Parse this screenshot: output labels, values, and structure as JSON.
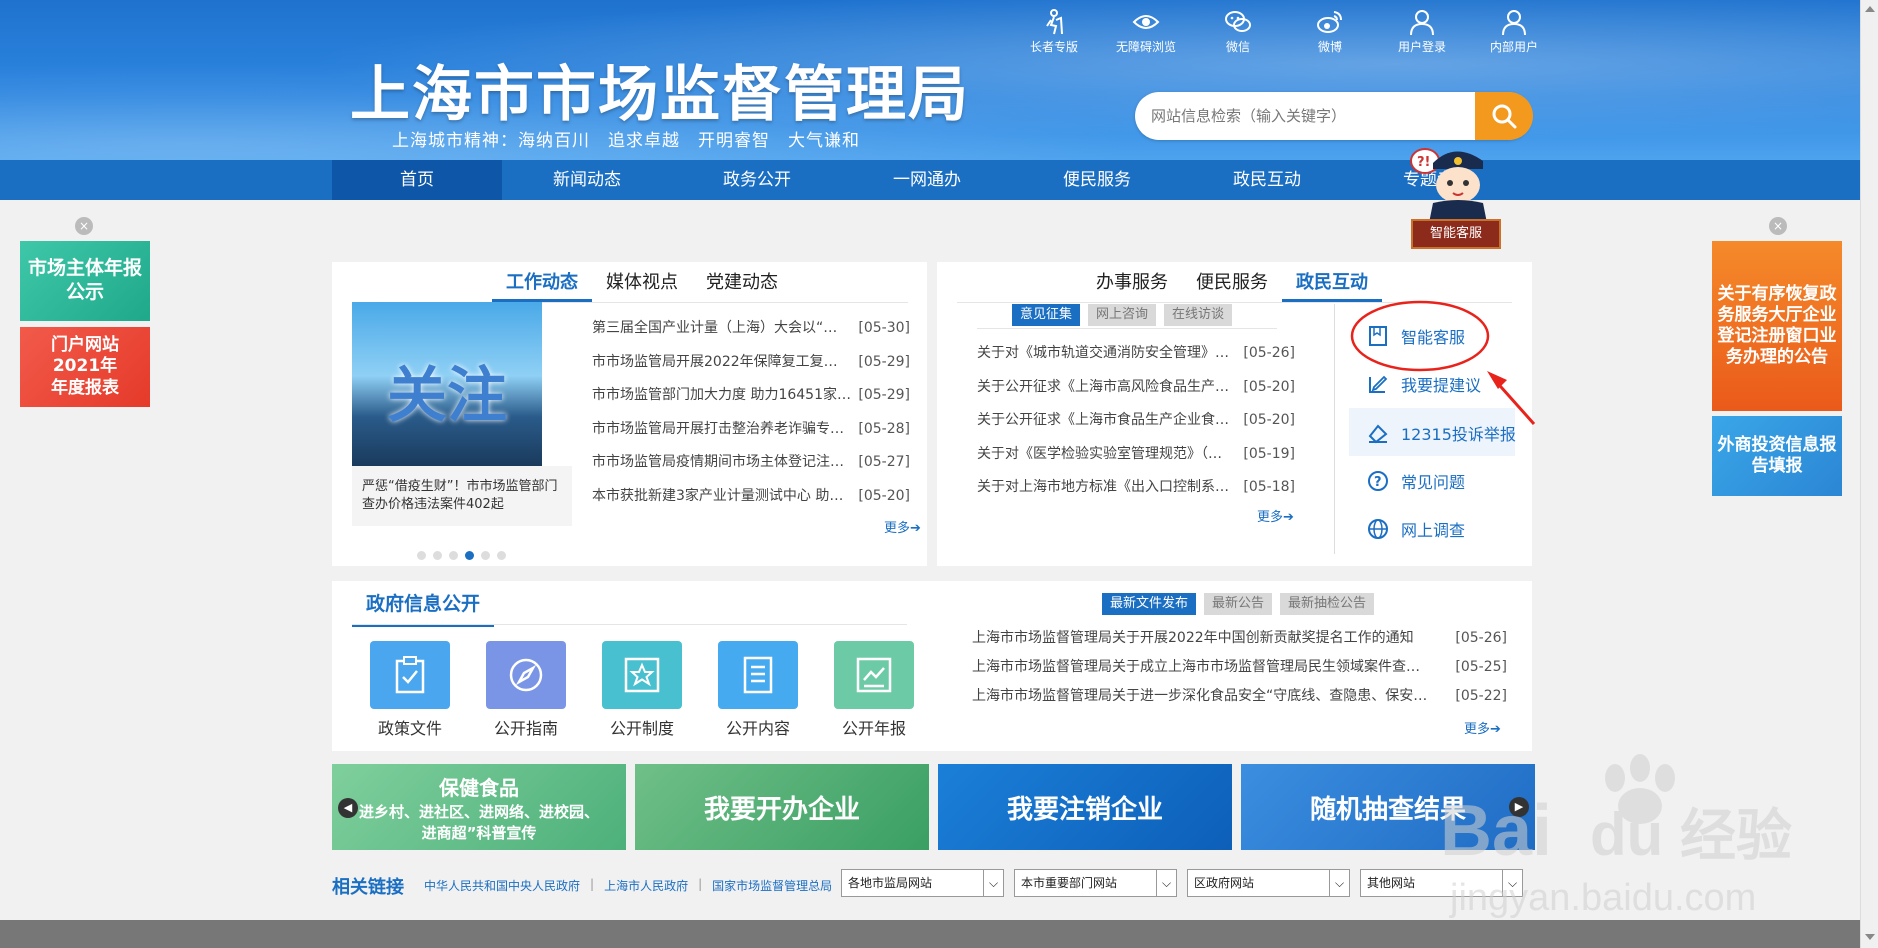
{
  "header": {
    "site_title": "上海市市场监督管理局",
    "motto": "上海城市精神：海纳百川　追求卓越　开明睿智　大气谦和",
    "tools": [
      {
        "label": "长者专版",
        "icon": "elder-icon"
      },
      {
        "label": "无障碍浏览",
        "icon": "eye-icon"
      },
      {
        "label": "微信",
        "icon": "wechat-icon"
      },
      {
        "label": "微博",
        "icon": "weibo-icon"
      },
      {
        "label": "用户登录",
        "icon": "user-icon"
      },
      {
        "label": "内部用户",
        "icon": "user-icon"
      }
    ],
    "search_placeholder": "网站信息检索（输入关键字）"
  },
  "nav": {
    "items": [
      "首页",
      "新闻动态",
      "政务公开",
      "一网通办",
      "便民服务",
      "政民互动",
      "专题专栏"
    ]
  },
  "robot": {
    "label": "智能客服",
    "bubble": "?!"
  },
  "left_ads": {
    "ad1": "市场主体年报公示",
    "ad2_line1": "门户网站",
    "ad2_line2": "2021年",
    "ad2_line3": "年度报表"
  },
  "right_ads": {
    "ad1": "关于有序恢复政务服务大厅企业登记注册窗口业务办理的公告",
    "ad2": "外商投资信息报告填报"
  },
  "news_card": {
    "tabs": [
      "工作动态",
      "媒体视点",
      "党建动态"
    ],
    "image_text": "关注",
    "caption": "严惩“借疫生财”！市市场监管部门查办价格违法案件402起",
    "items": [
      {
        "title": "第三届全国产业计量（上海）大会以“…",
        "date": "[05-30]"
      },
      {
        "title": "市市场监管局开展2022年保障复工复…",
        "date": "[05-29]"
      },
      {
        "title": "市市场监管部门加大力度 助力16451家…",
        "date": "[05-29]"
      },
      {
        "title": "市市场监管局开展打击整治养老诈骗专…",
        "date": "[05-28]"
      },
      {
        "title": "市市场监管局疫情期间市场主体登记注…",
        "date": "[05-27]"
      },
      {
        "title": "本市获批新建3家产业计量测试中心 助…",
        "date": "[05-20]"
      }
    ],
    "more": "更多➔"
  },
  "interact_card": {
    "tabs": [
      "办事服务",
      "便民服务",
      "政民互动"
    ],
    "pills": [
      "意见征集",
      "网上咨询",
      "在线访谈"
    ],
    "items": [
      {
        "title": "关于对《城市轨道交通消防安全管理》…",
        "date": "[05-26]"
      },
      {
        "title": "关于公开征求《上海市高风险食品生产…",
        "date": "[05-20]"
      },
      {
        "title": "关于公开征求《上海市食品生产企业食…",
        "date": "[05-20]"
      },
      {
        "title": "关于对《医学检验实验室管理规范》（…",
        "date": "[05-19]"
      },
      {
        "title": "关于对上海市地方标准《出入口控制系…",
        "date": "[05-18]"
      }
    ],
    "more": "更多➔",
    "services": [
      "智能客服",
      "我要提建议",
      "12315投诉举报",
      "常见问题",
      "网上调查"
    ]
  },
  "gov_card": {
    "title": "政府信息公开",
    "icons": [
      "政策文件",
      "公开指南",
      "公开制度",
      "公开内容",
      "公开年报"
    ],
    "pills": [
      "最新文件发布",
      "最新公告",
      "最新抽检公告"
    ],
    "items": [
      {
        "title": "上海市市场监督管理局关于开展2022年中国创新贡献奖提名工作的通知",
        "date": "[05-26]"
      },
      {
        "title": "上海市市场监督管理局关于成立上海市市场监督管理局民生领域案件查…",
        "date": "[05-25]"
      },
      {
        "title": "上海市市场监督管理局关于进一步深化食品安全“守底线、查隐患、保安…",
        "date": "[05-22]"
      }
    ],
    "more": "更多➔"
  },
  "banners": {
    "b1_title": "保健食品",
    "b1_sub1": "进乡村、进社区、进网络、进校园、",
    "b1_sub2": "进商超”科普宣传",
    "b2": "我要开办企业",
    "b3": "我要注销企业",
    "b4": "随机抽查结果"
  },
  "links": {
    "title": "相关链接",
    "items": [
      "中华人民共和国中央人民政府",
      "上海市人民政府",
      "国家市场监督管理总局"
    ],
    "selects": [
      "各地市监局网站",
      "本市重要部门网站",
      "区政府网站",
      "其他网站"
    ]
  },
  "watermark": {
    "brand": "Bai",
    "du": "du",
    "cn": "经验",
    "url": "jingyan.baidu.com"
  }
}
